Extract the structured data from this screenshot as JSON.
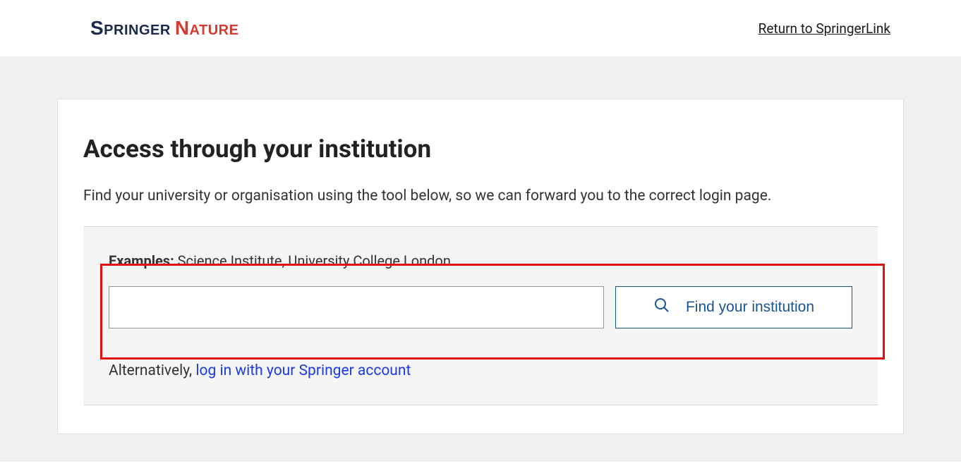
{
  "header": {
    "logo_springer": "Springer",
    "logo_nature": "Nature",
    "return_link": "Return to SpringerLink"
  },
  "main": {
    "title": "Access through your institution",
    "description": "Find your university or organisation using the tool below, so we can forward you to the correct login page.",
    "examples_label": "Examples:",
    "examples_text": " Science Institute, University College London",
    "search_value": "",
    "find_button_label": "Find your institution",
    "alternatively_text": "Alternatively, ",
    "springer_login_link": "log in with your Springer account"
  }
}
